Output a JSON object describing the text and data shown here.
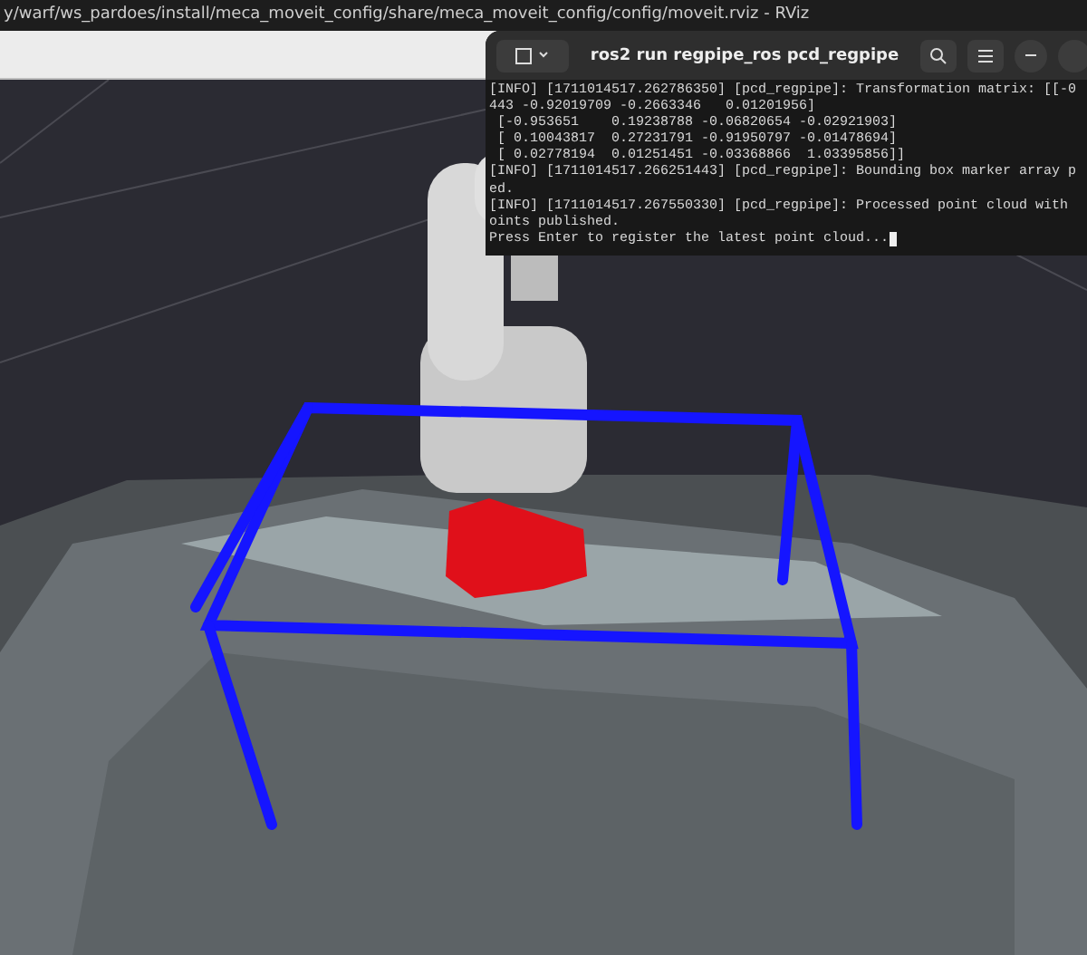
{
  "window": {
    "title": "y/warf/ws_pardoes/install/meca_moveit_config/share/meca_moveit_config/config/moveit.rviz - RViz"
  },
  "terminal": {
    "title": "ros2 run regpipe_ros pcd_regpipe",
    "lines": [
      "[INFO] [1711014517.262786350] [pcd_regpipe]: Transformation matrix: [[-0",
      "443 -0.92019709 -0.2663346   0.01201956]",
      " [-0.953651    0.19238788 -0.06820654 -0.02921903]",
      " [ 0.10043817  0.27231791 -0.91950797 -0.01478694]",
      " [ 0.02778194  0.01251451 -0.03368866  1.03395856]]",
      "[INFO] [1711014517.266251443] [pcd_regpipe]: Bounding box marker array p",
      "ed.",
      "[INFO] [1711014517.267550330] [pcd_regpipe]: Processed point cloud with",
      "oints published.",
      "Press Enter to register the latest point cloud..."
    ]
  }
}
